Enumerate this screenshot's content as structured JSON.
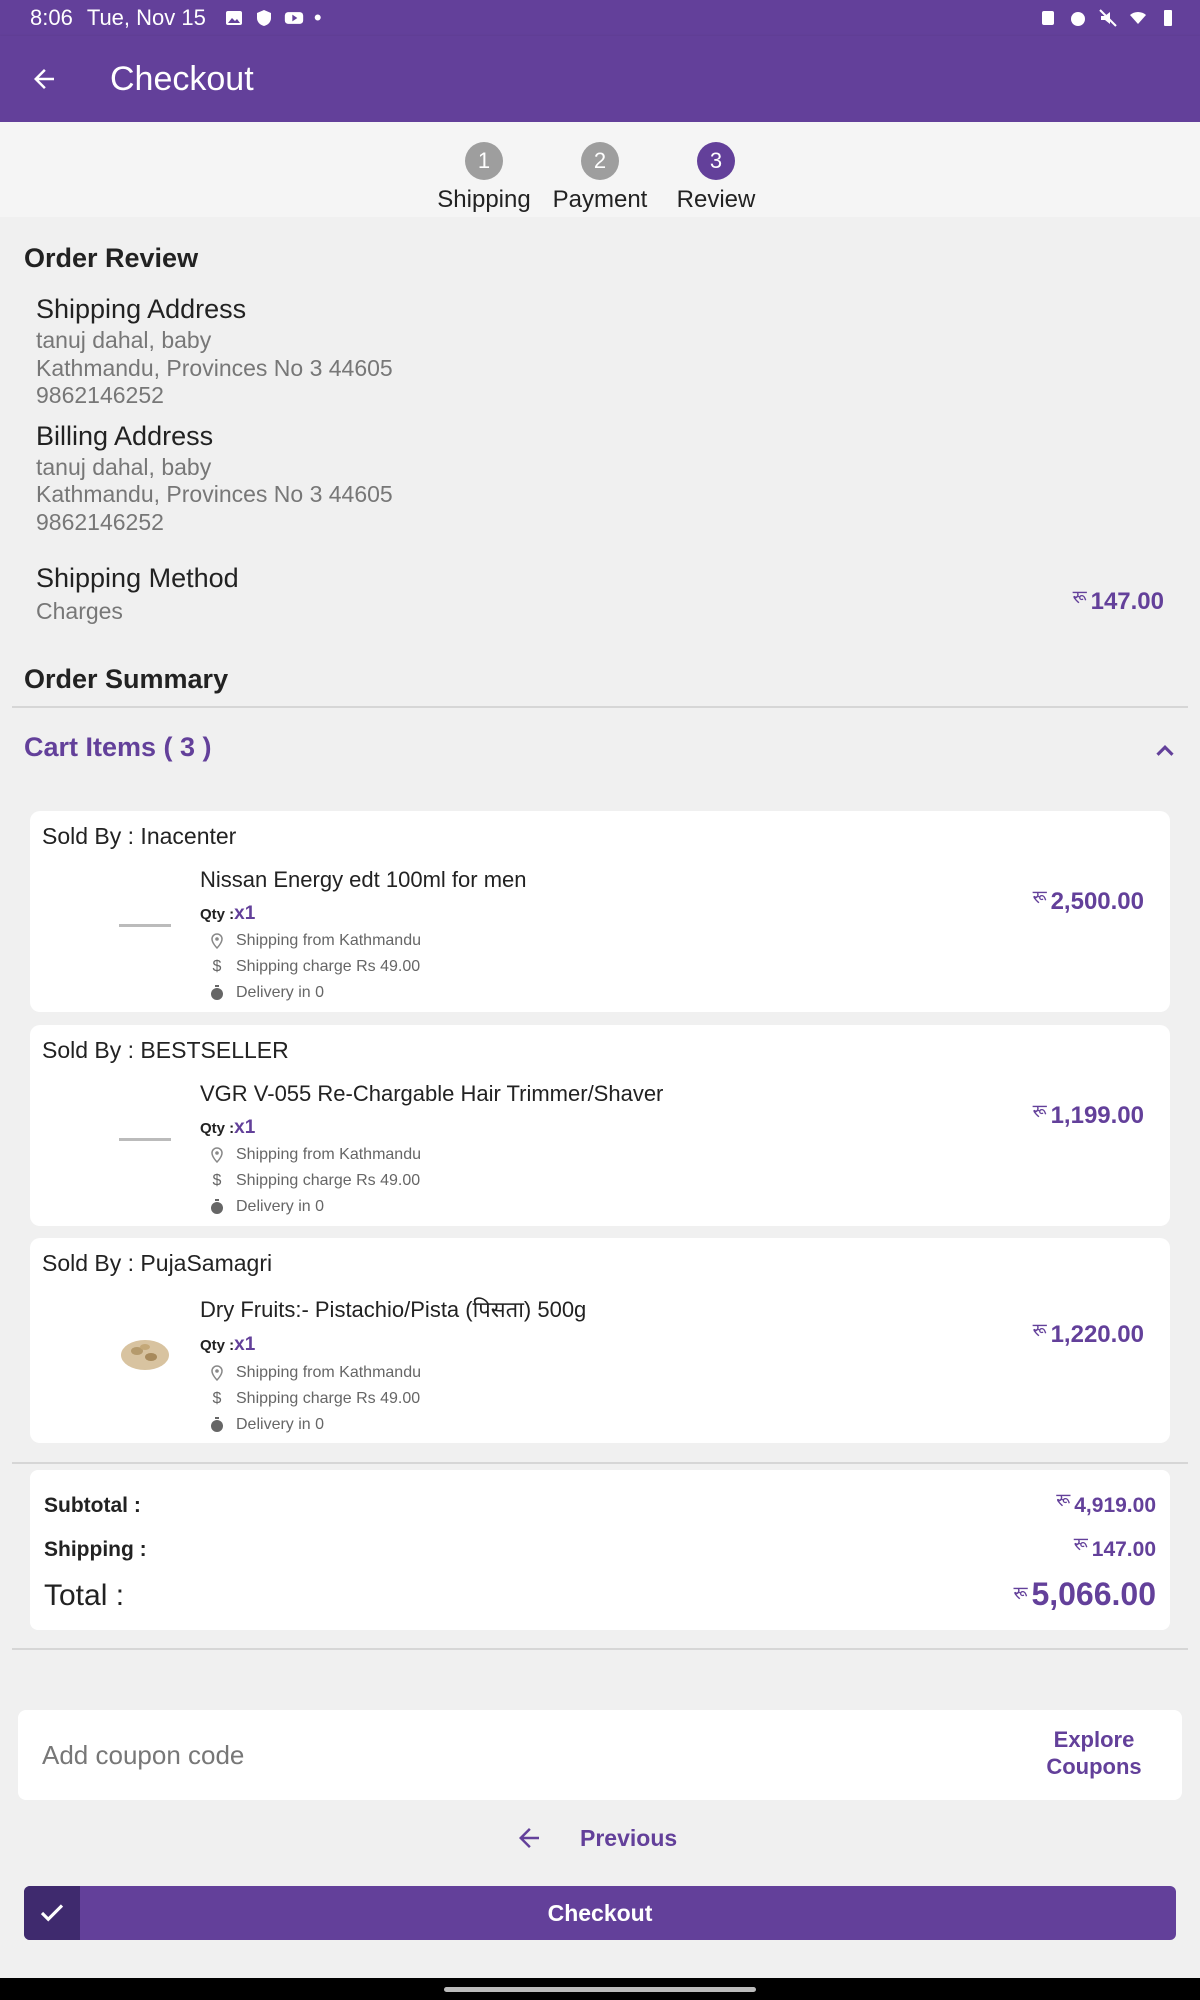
{
  "status_bar": {
    "time": "8:06",
    "date": "Tue, Nov 15"
  },
  "app_bar": {
    "title": "Checkout"
  },
  "steps": [
    {
      "number": "1",
      "label": "Shipping"
    },
    {
      "number": "2",
      "label": "Payment"
    },
    {
      "number": "3",
      "label": "Review"
    }
  ],
  "review": {
    "heading": "Order Review",
    "shipping_address": {
      "title": "Shipping Address",
      "name": "tanuj dahal, baby",
      "city": "Kathmandu, Provinces No 3 44605",
      "phone": "9862146252"
    },
    "billing_address": {
      "title": "Billing Address",
      "name": "tanuj dahal, baby",
      "city": "Kathmandu, Provinces No 3 44605",
      "phone": "9862146252"
    },
    "shipping_method": {
      "title": "Shipping Method",
      "subtitle": "Charges",
      "currency": "रू",
      "amount": "147.00"
    }
  },
  "summary": {
    "heading": "Order Summary",
    "cart_items_label": "Cart Items ( 3 )",
    "items": [
      {
        "seller": "Sold By : Inacenter",
        "name": "Nissan Energy edt 100ml for men",
        "qty_label": "Qty :",
        "qty": "x1",
        "ship_from": "Shipping from Kathmandu",
        "ship_charge": "Shipping charge Rs 49.00",
        "delivery": "Delivery in 0",
        "currency": "रू",
        "price": "2,500.00"
      },
      {
        "seller": "Sold By : BESTSELLER",
        "name": "VGR V-055 Re-Chargable Hair Trimmer/Shaver",
        "qty_label": "Qty :",
        "qty": "x1",
        "ship_from": "Shipping from Kathmandu",
        "ship_charge": "Shipping charge Rs 49.00",
        "delivery": "Delivery in 0",
        "currency": "रू",
        "price": "1,199.00"
      },
      {
        "seller": "Sold By : PujaSamagri",
        "name": "Dry Fruits:- Pistachio/Pista (पिसता) 500g",
        "qty_label": "Qty :",
        "qty": "x1",
        "ship_from": "Shipping from Kathmandu",
        "ship_charge": "Shipping charge Rs 49.00",
        "delivery": "Delivery in 0",
        "currency": "रू",
        "price": "1,220.00"
      }
    ],
    "totals": {
      "subtotal_label": "Subtotal :",
      "subtotal": "4,919.00",
      "shipping_label": "Shipping :",
      "shipping": "147.00",
      "total_label": "Total :",
      "total": "5,066.00",
      "currency": "रू"
    }
  },
  "coupon": {
    "placeholder": "Add coupon code",
    "explore_line1": "Explore",
    "explore_line2": "Coupons"
  },
  "nav": {
    "previous_label": "Previous",
    "checkout_label": "Checkout"
  },
  "colors": {
    "primary": "#63409a",
    "primary_dark": "#3f2a6e",
    "background": "#f0f0f0"
  }
}
